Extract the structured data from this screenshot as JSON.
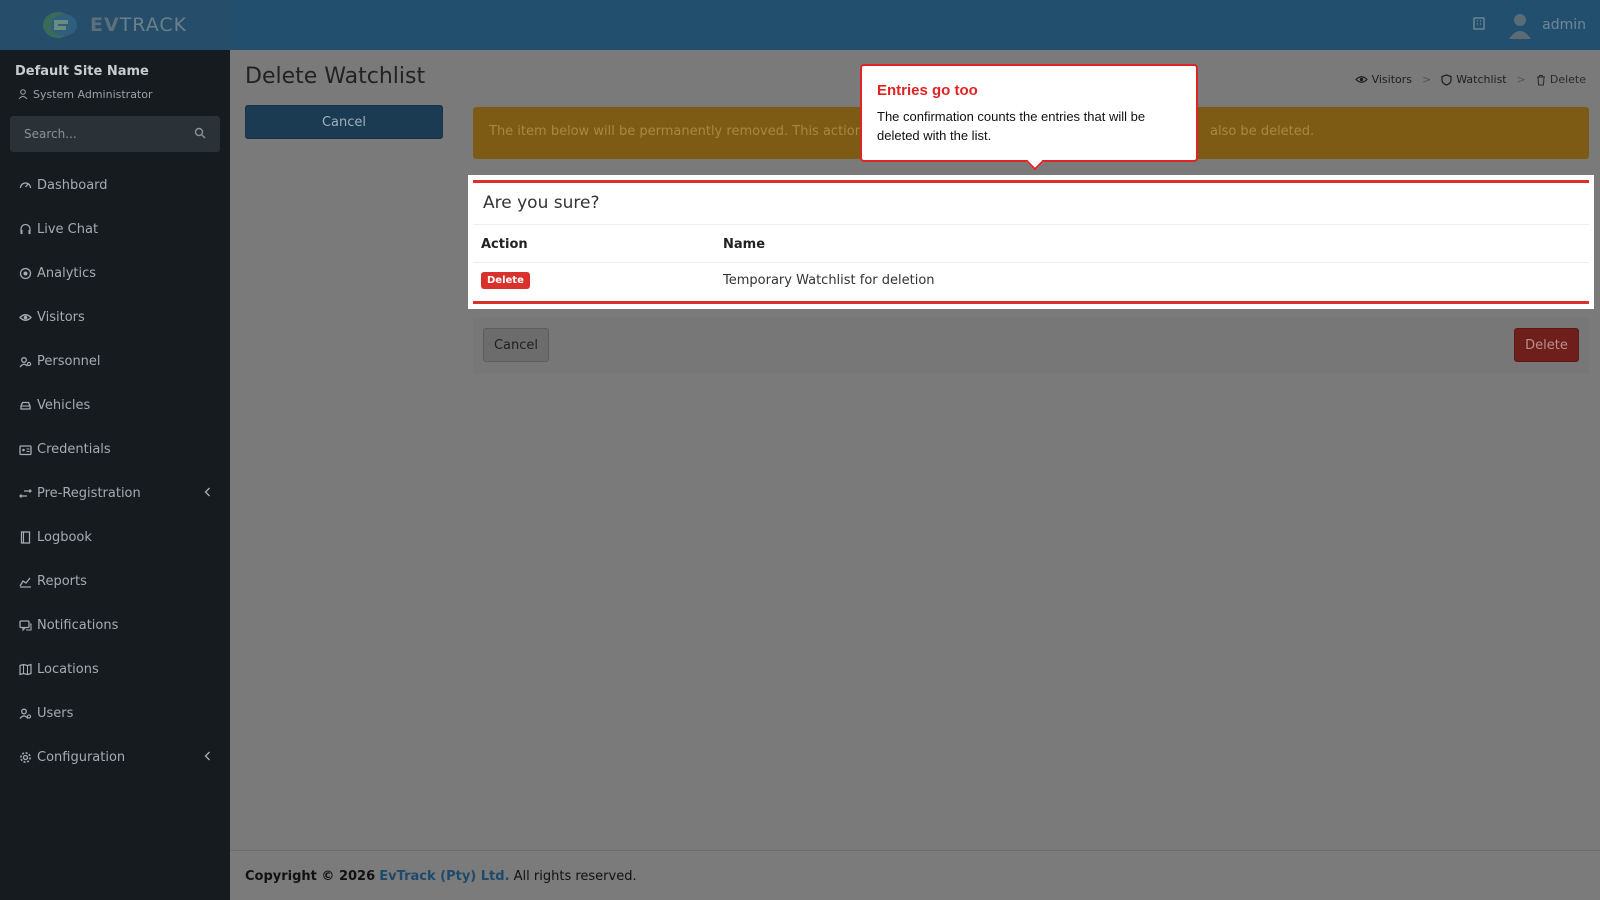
{
  "brand": {
    "logo_text_bold": "EV",
    "logo_text_thin": "TRACK"
  },
  "topbar": {
    "username": "admin"
  },
  "sidebar": {
    "site_name": "Default Site Name",
    "site_role": "System Administrator",
    "search_placeholder": "Search...",
    "items": [
      {
        "label": "Dashboard",
        "icon": "dashboard-icon"
      },
      {
        "label": "Live Chat",
        "icon": "headset-icon"
      },
      {
        "label": "Analytics",
        "icon": "target-icon"
      },
      {
        "label": "Visitors",
        "icon": "eye-icon"
      },
      {
        "label": "Personnel",
        "icon": "user-gear-icon"
      },
      {
        "label": "Vehicles",
        "icon": "car-icon"
      },
      {
        "label": "Credentials",
        "icon": "id-card-icon"
      },
      {
        "label": "Pre-Registration",
        "icon": "arrows-icon",
        "has_children": true
      },
      {
        "label": "Logbook",
        "icon": "book-icon"
      },
      {
        "label": "Reports",
        "icon": "chart-icon"
      },
      {
        "label": "Notifications",
        "icon": "chat-icon"
      },
      {
        "label": "Locations",
        "icon": "map-icon"
      },
      {
        "label": "Users",
        "icon": "users-icon"
      },
      {
        "label": "Configuration",
        "icon": "gear-icon",
        "has_children": true
      }
    ]
  },
  "page": {
    "title": "Delete Watchlist",
    "left_cancel_label": "Cancel",
    "alert_left": "The item below will be permanently removed. This action cann",
    "alert_right": "also be deleted.",
    "breadcrumb": [
      "Visitors",
      "Watchlist",
      "Delete"
    ]
  },
  "modal": {
    "title": "Are you sure?",
    "columns": [
      "Action",
      "Name"
    ],
    "row": {
      "action_badge": "Delete",
      "name": "Temporary Watchlist for deletion"
    },
    "cancel_label": "Cancel",
    "delete_label": "Delete"
  },
  "callout": {
    "title": "Entries go too",
    "body": "The confirmation counts the entries that will be deleted with the list."
  },
  "footer": {
    "copyright": "Copyright © 2026",
    "company": "EvTrack (Pty) Ltd.",
    "rights": "All rights reserved."
  },
  "colors": {
    "header": "#234f6e",
    "sidebar": "#161b1f",
    "danger": "#d9322c",
    "callout_border": "#e02424"
  }
}
